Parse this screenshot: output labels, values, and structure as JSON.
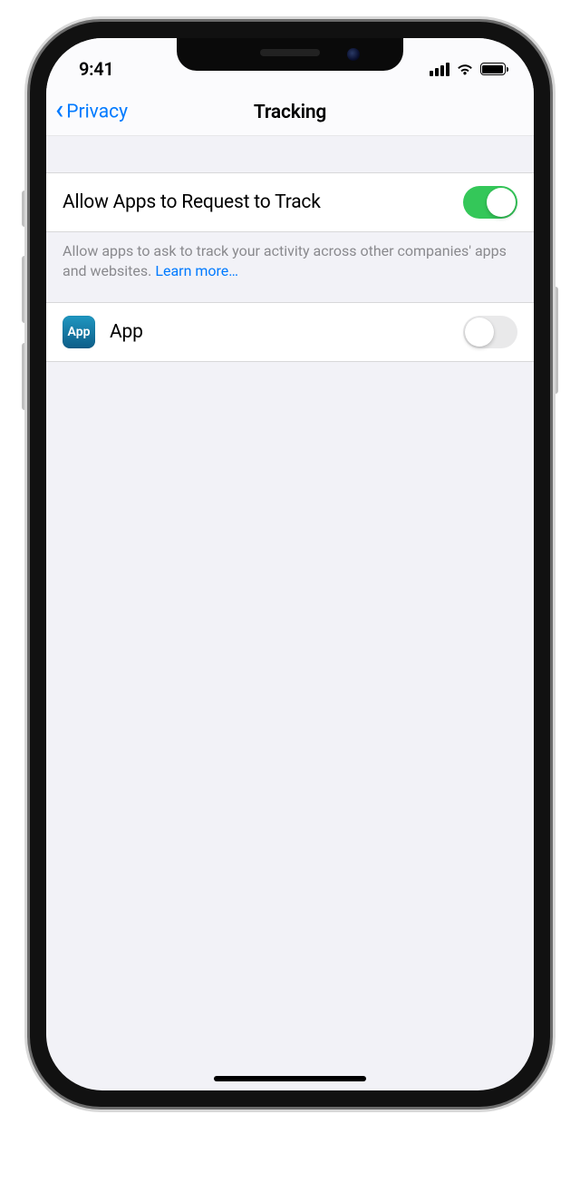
{
  "status": {
    "time": "9:41"
  },
  "nav": {
    "back_label": "Privacy",
    "title": "Tracking"
  },
  "settings": {
    "allow_track": {
      "label": "Allow Apps to Request to Track",
      "on": true
    },
    "footer_leading": "Allow apps to ask to track your activity across other companies' apps and websites. ",
    "footer_link": "Learn more…"
  },
  "apps": [
    {
      "icon_text": "App",
      "name": "App",
      "on": false
    }
  ]
}
